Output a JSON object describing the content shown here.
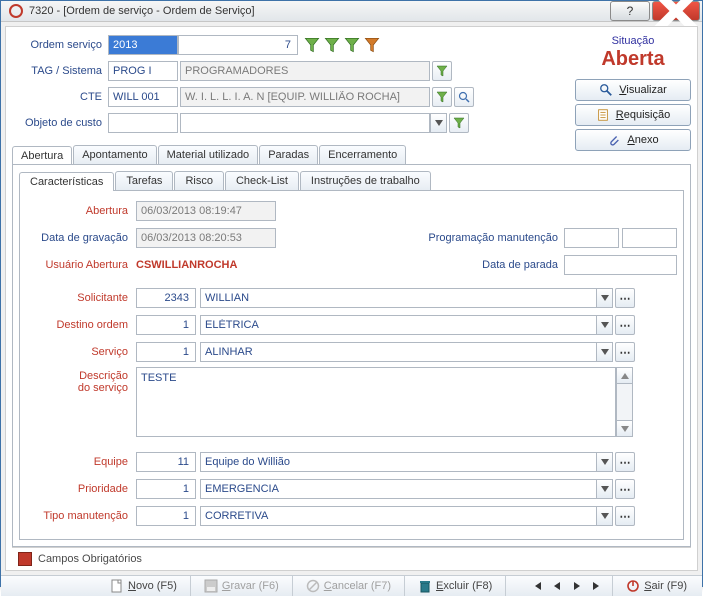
{
  "window": {
    "title": "7320 - [Ordem de serviço - Ordem de Serviço]"
  },
  "situacao": {
    "label": "Situação",
    "value": "Aberta"
  },
  "header_fields": {
    "ordem_servico_label": "Ordem serviço",
    "ordem_servico_value": "2013",
    "ordem_servico_seq": "7",
    "tag_label": "TAG / Sistema",
    "tag_code": "PROG I",
    "tag_desc": "PROGRAMADORES",
    "cte_label": "CTE",
    "cte_code": "WILL 001",
    "cte_desc": "W. I. L. L. I. A. N [EQUIP. WILLIÃO ROCHA]",
    "objeto_label": "Objeto de custo",
    "objeto_code": "",
    "objeto_desc": ""
  },
  "action_buttons": {
    "visualizar": "Visualizar",
    "requisicao": "Requisição",
    "anexo": "Anexo"
  },
  "main_tabs": {
    "abertura": "Abertura",
    "apontamento": "Apontamento",
    "material": "Material utilizado",
    "paradas": "Paradas",
    "encerramento": "Encerramento"
  },
  "sub_tabs": {
    "caracteristicas": "Características",
    "tarefas": "Tarefas",
    "risco": "Risco",
    "checklist": "Check-List",
    "instrucoes": "Instruções de trabalho"
  },
  "details": {
    "abertura_label": "Abertura",
    "abertura_value": "06/03/2013 08:19:47",
    "gravacao_label": "Data de gravação",
    "gravacao_value": "06/03/2013 08:20:53",
    "usuario_label": "Usuário Abertura",
    "usuario_value": "CSWILLIANROCHA",
    "prog_label": "Programação manutenção",
    "prog_v1": "",
    "prog_v2": "",
    "parada_label": "Data de parada",
    "parada_value": "",
    "solicitante_label": "Solicitante",
    "solicitante_code": "2343",
    "solicitante_desc": "WILLIAN",
    "destino_label": "Destino ordem",
    "destino_code": "1",
    "destino_desc": "ELÉTRICA",
    "servico_label": "Serviço",
    "servico_code": "1",
    "servico_desc": "ALINHAR",
    "descricao_label1": "Descrição",
    "descricao_label2": "do serviço",
    "descricao_value": "TESTE",
    "equipe_label": "Equipe",
    "equipe_code": "11",
    "equipe_desc": "Equipe do Willião",
    "prioridade_label": "Prioridade",
    "prioridade_code": "1",
    "prioridade_desc": "EMERGENCIA",
    "tipo_label": "Tipo manutenção",
    "tipo_code": "1",
    "tipo_desc": "CORRETIVA"
  },
  "legend": {
    "text": "Campos Obrigatórios"
  },
  "toolbar": {
    "novo": "Novo (F5)",
    "gravar": "Gravar (F6)",
    "cancelar": "Cancelar (F7)",
    "excluir": "Excluir (F8)",
    "sair": "Sair (F9)"
  }
}
